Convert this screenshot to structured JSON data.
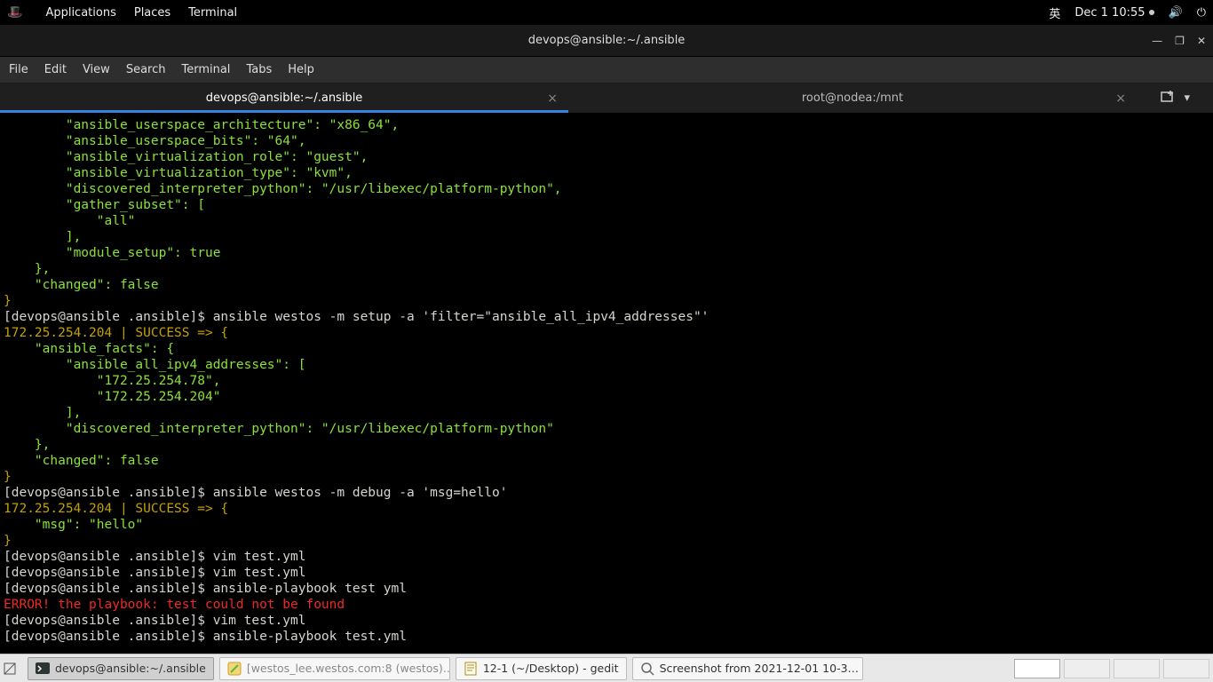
{
  "topbar": {
    "applications": "Applications",
    "places": "Places",
    "terminal": "Terminal",
    "lang": "英",
    "clock": "Dec 1  10:55"
  },
  "window": {
    "title": "devops@ansible:~/.ansible"
  },
  "menubar": {
    "file": "File",
    "edit": "Edit",
    "view": "View",
    "search": "Search",
    "terminal": "Terminal",
    "tabs": "Tabs",
    "help": "Help"
  },
  "tabs": {
    "t0": "devops@ansible:~/.ansible",
    "t1": "root@nodea:/mnt"
  },
  "term": {
    "l1": "        \"ansible_userspace_architecture\": \"x86_64\",",
    "l2": "        \"ansible_userspace_bits\": \"64\",",
    "l3": "        \"ansible_virtualization_role\": \"guest\",",
    "l4": "        \"ansible_virtualization_type\": \"kvm\",",
    "l5": "        \"discovered_interpreter_python\": \"/usr/libexec/platform-python\",",
    "l6": "        \"gather_subset\": [",
    "l7": "            \"all\"",
    "l8": "        ],",
    "l9": "        \"module_setup\": true",
    "l10": "    },",
    "l11": "    \"changed\": false",
    "l12": "}",
    "p1a": "[devops@ansible .ansible]$ ",
    "p1b": "ansible westos -m setup -a 'filter=\"ansible_all_ipv4_addresses\"'",
    "l13": "172.25.254.204 | SUCCESS => {",
    "l14": "    \"ansible_facts\": {",
    "l15": "        \"ansible_all_ipv4_addresses\": [",
    "l16": "            \"172.25.254.78\",",
    "l17": "            \"172.25.254.204\"",
    "l18": "        ],",
    "l19": "        \"discovered_interpreter_python\": \"/usr/libexec/platform-python\"",
    "l20": "    },",
    "l21": "    \"changed\": false",
    "l22": "}",
    "p2a": "[devops@ansible .ansible]$ ",
    "p2b": "ansible westos -m debug -a 'msg=hello'",
    "l23": "172.25.254.204 | SUCCESS => {",
    "l24": "    \"msg\": \"hello\"",
    "l25": "}",
    "p3a": "[devops@ansible .ansible]$ ",
    "p3b": "vim test.yml",
    "p4a": "[devops@ansible .ansible]$ ",
    "p4b": "vim test.yml",
    "p5a": "[devops@ansible .ansible]$ ",
    "p5b": "ansible-playbook test yml",
    "err": "ERROR! the playbook: test could not be found",
    "p6a": "[devops@ansible .ansible]$ ",
    "p6b": "vim test.yml",
    "p7a": "[devops@ansible .ansible]$ ",
    "p7b": "ansible-playbook test.yml"
  },
  "taskbar": {
    "t1": "devops@ansible:~/.ansible",
    "t2": "[westos_lee.westos.com:8 (westos)…",
    "t3": "12-1 (~/Desktop) - gedit",
    "t4": "Screenshot from 2021-12-01 10-3…"
  }
}
